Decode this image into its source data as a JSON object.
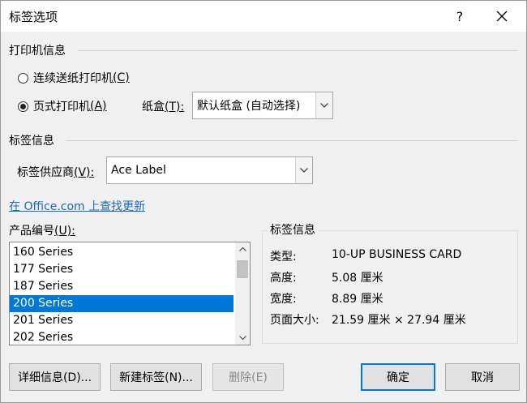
{
  "window": {
    "title": "标签选项",
    "help": "?"
  },
  "printer_info": {
    "heading": "打印机信息",
    "continuous": {
      "label": "连续送纸打印机",
      "key": "(C)",
      "checked": false
    },
    "page": {
      "label": "页式打印机",
      "key": "(A)",
      "checked": true
    },
    "tray": {
      "label": "纸盒",
      "key": "(T):",
      "value": "默认纸盒 (自动选择)"
    }
  },
  "label_info": {
    "heading": "标签信息",
    "vendor_label": "标签供应商",
    "vendor_key": "(V):",
    "vendor_value": "Ace Label",
    "update_link": "在 Office.com 上查找更新"
  },
  "product": {
    "label": "产品编号",
    "key": "(U):",
    "items": [
      "160 Series",
      "177 Series",
      "187 Series",
      "200 Series",
      "201 Series",
      "202 Series"
    ],
    "selected": "200 Series"
  },
  "details": {
    "heading": "标签信息",
    "type_k": "类型:",
    "type_v": "10-UP BUSINESS CARD",
    "height_k": "高度:",
    "height_v": "5.08 厘米",
    "width_k": "宽度:",
    "width_v": "8.89 厘米",
    "page_k": "页面大小:",
    "page_v": "21.59 厘米 × 27.94 厘米"
  },
  "buttons": {
    "details": "详细信息(D)...",
    "new_label": "新建标签(N)...",
    "delete": "删除(E)",
    "ok": "确定",
    "cancel": "取消"
  }
}
